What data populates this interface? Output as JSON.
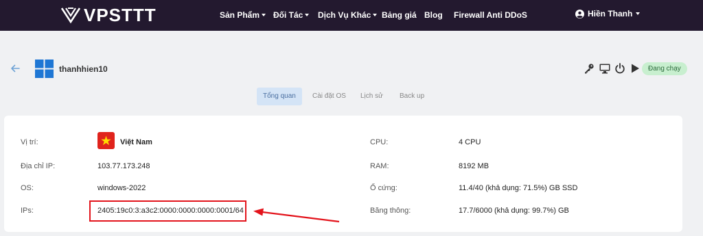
{
  "nav": {
    "brand": "VPSTTT",
    "items": [
      {
        "label": "Sản Phẩm",
        "dropdown": true
      },
      {
        "label": "Đối Tác",
        "dropdown": true
      },
      {
        "label": "Dịch Vụ Khác",
        "dropdown": true
      },
      {
        "label": "Bảng giá",
        "dropdown": false
      },
      {
        "label": "Blog",
        "dropdown": false
      },
      {
        "label": "Firewall Anti DDoS",
        "dropdown": false
      }
    ],
    "user": "Hiền Thanh"
  },
  "server": {
    "name": "thanhhien10",
    "status": "Đang chạy"
  },
  "tabs": [
    {
      "label": "Tổng quan",
      "active": true
    },
    {
      "label": "Cài đặt OS",
      "active": false
    },
    {
      "label": "Lịch sử",
      "active": false
    },
    {
      "label": "Back up",
      "active": false
    }
  ],
  "info": {
    "location_label": "Vị trí:",
    "location_value": "Việt Nam",
    "ip_label": "Địa chỉ IP:",
    "ip_value": "103.77.173.248",
    "os_label": "OS:",
    "os_value": "windows-2022",
    "ips_label": "IPs:",
    "ips_value": "2405:19c0:3:a3c2:0000:0000:0000:0001/64",
    "cpu_label": "CPU:",
    "cpu_value": "4 CPU",
    "ram_label": "RAM:",
    "ram_value": "8192 MB",
    "disk_label": "Ổ cứng:",
    "disk_value": "11.4/40 (khả dụng: 71.5%) GB SSD",
    "bandwidth_label": "Băng thông:",
    "bandwidth_value": "17.7/6000 (khả dụng: 99.7%) GB"
  },
  "icons": {
    "back": "arrow-left-icon",
    "os": "windows-logo-icon",
    "key": "key-icon",
    "console": "monitor-icon",
    "power": "power-icon",
    "start": "play-icon",
    "flag": "vietnam-flag-icon",
    "user": "user-circle-icon"
  },
  "colors": {
    "navbar": "#23192f",
    "status_bg": "#c8efcf",
    "active_tab": "#d4e4f6",
    "annotation": "#e3131b"
  }
}
